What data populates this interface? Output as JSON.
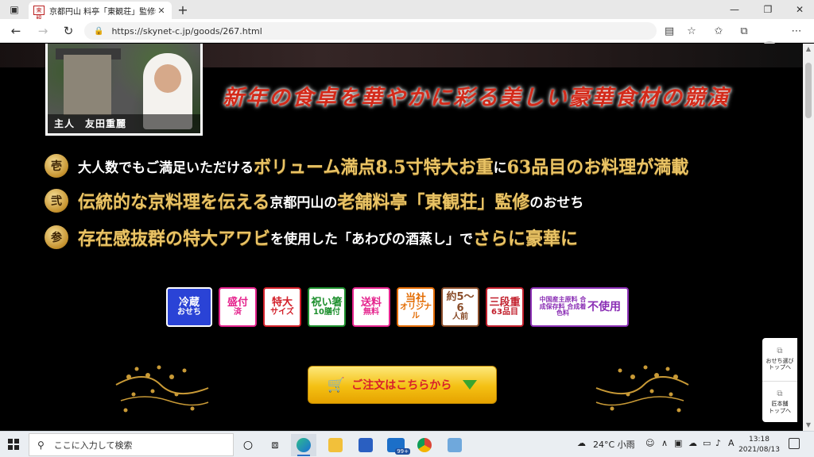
{
  "browser": {
    "tab_title": "京都円山 料亭「東観荘」監修特大",
    "tab_favicon": "東観",
    "url": "https://skynet-c.jp/goods/267.html"
  },
  "page": {
    "photo_caption": "主人　友田重麗",
    "headline": "新年の食卓を華やかに彩る美しい豪華食材の競演",
    "features": [
      {
        "badge": "壱",
        "parts": [
          {
            "text": "大人数でもご満足いただける",
            "style": "white"
          },
          {
            "text": "ボリューム満点8.5寸特大お重",
            "style": "gold"
          },
          {
            "text": "に",
            "style": "white"
          },
          {
            "text": "63品目のお料理が満載",
            "style": "gold"
          }
        ]
      },
      {
        "badge": "弐",
        "parts": [
          {
            "text": "伝統的な京料理を伝える",
            "style": "gold"
          },
          {
            "text": "京都円山の",
            "style": "white"
          },
          {
            "text": "老舗料亭「東観荘」監修",
            "style": "gold"
          },
          {
            "text": "のおせち",
            "style": "white"
          }
        ]
      },
      {
        "badge": "参",
        "parts": [
          {
            "text": "存在感抜群の特大アワビ",
            "style": "gold"
          },
          {
            "text": "を使用した「あわびの酒蒸し」で",
            "style": "white"
          },
          {
            "text": "さらに豪華に",
            "style": "gold"
          }
        ]
      }
    ],
    "tags": [
      {
        "a": "冷蔵",
        "b": "おせち",
        "color": "#ffffff",
        "bg": "#2a43d6",
        "border": "#ffffff",
        "w": 58
      },
      {
        "a": "盛付",
        "b": "済",
        "color": "#e5238d",
        "bg": "#ffffff",
        "border": "#e5238d",
        "w": 48
      },
      {
        "a": "特大",
        "b": "サイズ",
        "color": "#d3202a",
        "bg": "#ffffff",
        "border": "#d3202a",
        "w": 48
      },
      {
        "a": "祝い箸",
        "b": "10膳付",
        "color": "#1c8f2d",
        "bg": "#ffffff",
        "border": "#1c8f2d",
        "w": 48
      },
      {
        "a": "送料",
        "b": "無料",
        "color": "#e5238d",
        "bg": "#ffffff",
        "border": "#e5238d",
        "w": 48
      },
      {
        "a": "当社",
        "b": "オリジナル",
        "color": "#e36b00",
        "bg": "#ffffff",
        "border": "#e36b00",
        "w": 48
      },
      {
        "a": "約5〜6",
        "b": "人前",
        "color": "#8a4d2a",
        "bg": "#ffffff",
        "border": "#8a4d2a",
        "w": 48
      },
      {
        "a": "三段重",
        "b": "63品目",
        "color": "#c21f2c",
        "bg": "#ffffff",
        "border": "#c21f2c",
        "w": 48
      },
      {
        "a": "不使用",
        "b": "中国産主原料 合成保存料 合成着色料",
        "color": "#8b2fb5",
        "bg": "#ffffff",
        "border": "#8b2fb5",
        "w": 124
      }
    ],
    "order_button": "ご注文はこちらから",
    "side_widget": [
      {
        "label": "おせち選び\nトップへ"
      },
      {
        "label": "匠本舗\nトップへ"
      }
    ]
  },
  "taskbar": {
    "search_placeholder": "ここに入力して検索",
    "weather": "24°C 小雨",
    "ime": "A",
    "time": "13:18",
    "date": "2021/08/13",
    "mail_badge": "99+"
  }
}
